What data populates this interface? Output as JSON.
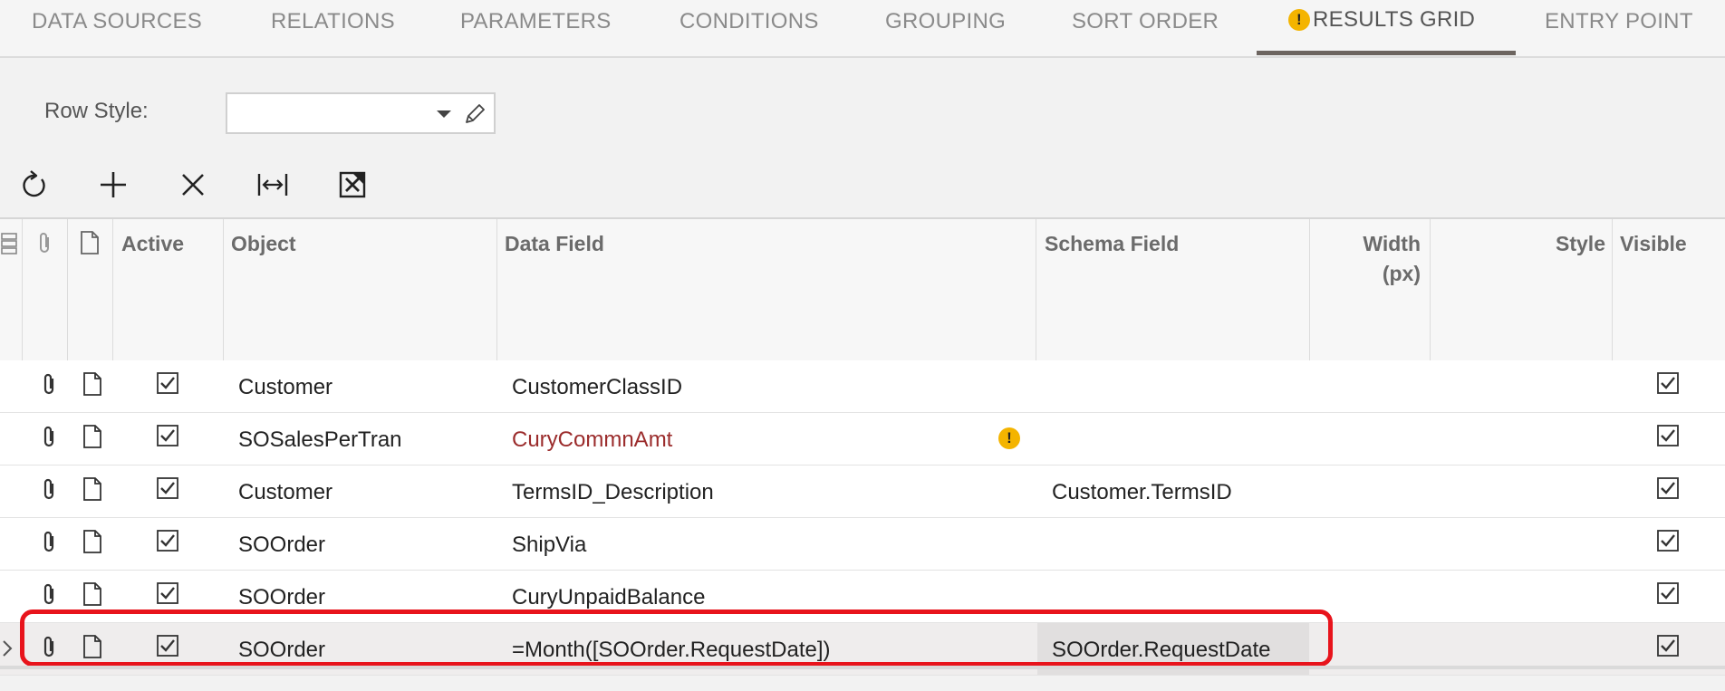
{
  "tabs": [
    {
      "label": "DATA SOURCES"
    },
    {
      "label": "RELATIONS"
    },
    {
      "label": "PARAMETERS"
    },
    {
      "label": "CONDITIONS"
    },
    {
      "label": "GROUPING"
    },
    {
      "label": "SORT ORDER"
    },
    {
      "label": "RESULTS GRID",
      "active": true,
      "warning": "!"
    },
    {
      "label": "ENTRY POINT"
    }
  ],
  "row_style": {
    "label": "Row Style:",
    "value": ""
  },
  "toolbar": {
    "icons": [
      "refresh-icon",
      "add-icon",
      "delete-icon",
      "fit-columns-icon",
      "export-excel-icon"
    ]
  },
  "grid": {
    "headers": {
      "active": "Active",
      "object": "Object",
      "data_field": "Data Field",
      "schema_field": "Schema Field",
      "width_line1": "Width",
      "width_line2": "(px)",
      "style": "Style",
      "visible": "Visible"
    },
    "rows": [
      {
        "object": "Customer",
        "data_field": "CustomerClassID",
        "schema_field": "",
        "active": true,
        "visible": true
      },
      {
        "object": "SOSalesPerTran",
        "data_field": "CuryCommnAmt",
        "schema_field": "",
        "active": true,
        "visible": true,
        "error": true,
        "warning": "!"
      },
      {
        "object": "Customer",
        "data_field": "TermsID_Description",
        "schema_field": "Customer.TermsID",
        "active": true,
        "visible": true
      },
      {
        "object": "SOOrder",
        "data_field": "ShipVia",
        "schema_field": "",
        "active": true,
        "visible": true
      },
      {
        "object": "SOOrder",
        "data_field": "CuryUnpaidBalance",
        "schema_field": "",
        "active": true,
        "visible": true
      },
      {
        "object": "SOOrder",
        "data_field": "=Month([SOOrder.RequestDate])",
        "schema_field": "SOOrder.RequestDate",
        "active": true,
        "visible": true,
        "selected": true
      }
    ]
  },
  "colors": {
    "accent": "#6d6560",
    "warning": "#f4b400",
    "error_text": "#9b2c2c",
    "highlight": "#e8141c"
  }
}
